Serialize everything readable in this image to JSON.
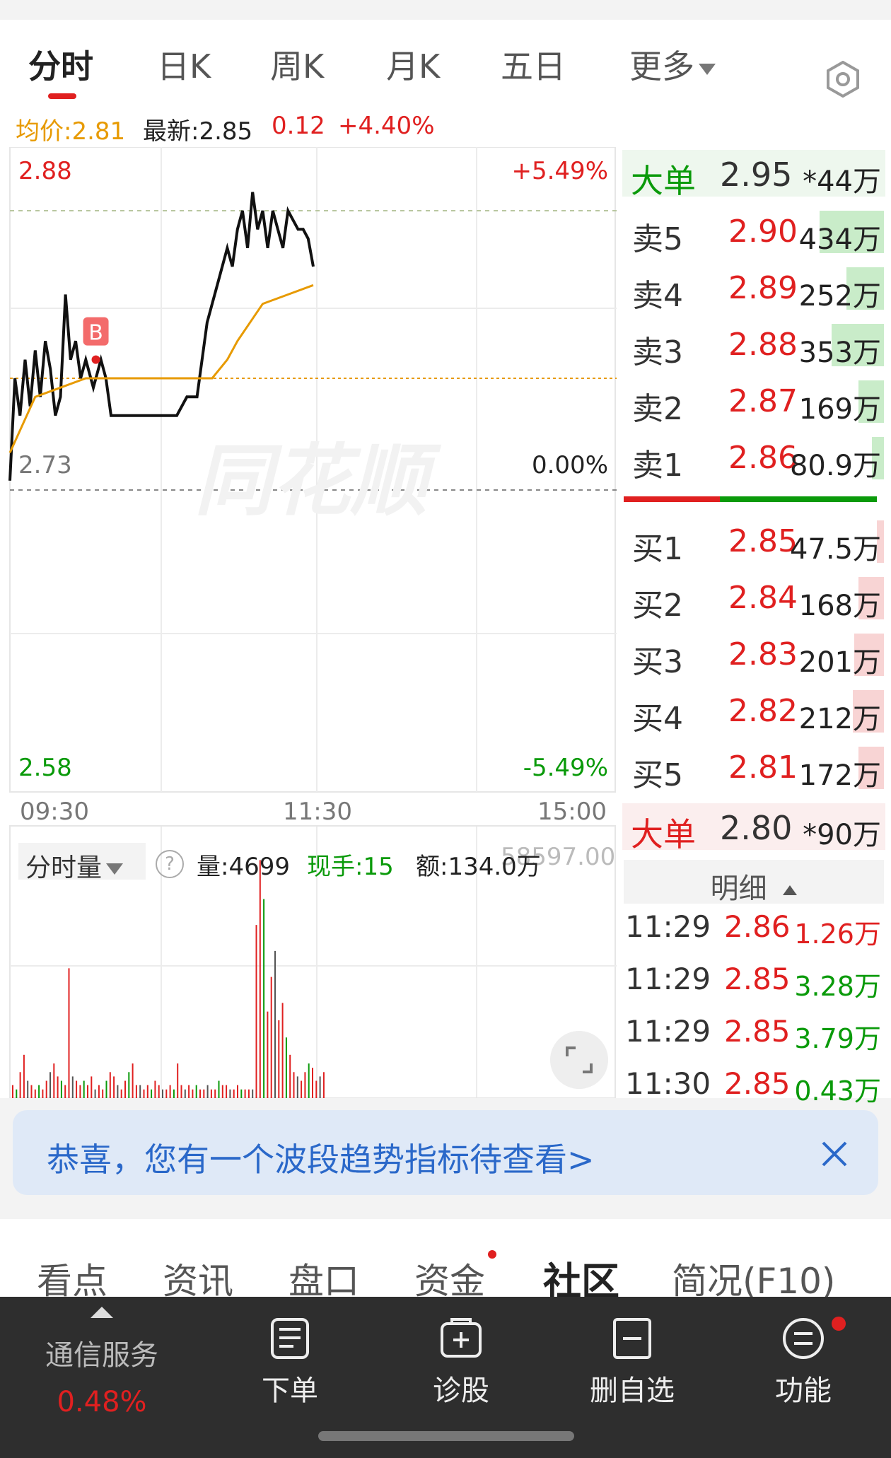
{
  "tabs": [
    {
      "label": "分时",
      "active": true
    },
    {
      "label": "日K",
      "active": false
    },
    {
      "label": "周K",
      "active": false
    },
    {
      "label": "月K",
      "active": false
    },
    {
      "label": "五日",
      "active": false
    },
    {
      "label": "更多",
      "active": false
    }
  ],
  "info": {
    "avg_price": "均价:2.81",
    "latest": "最新:2.85",
    "change": "0.12",
    "change_pct": "+4.40%"
  },
  "chart": {
    "price_high": "2.88",
    "price_mid": "2.73",
    "price_low": "2.58",
    "pct_high": "+5.49%",
    "pct_mid": "0.00%",
    "pct_low": "-5.49%",
    "time_start": "09:30",
    "time_mid": "11:30",
    "time_end": "15:00",
    "buy_marker": "B",
    "watermark": "同花顺"
  },
  "chart_data": {
    "type": "line",
    "x_range": [
      "09:30",
      "15:00"
    ],
    "ylim": [
      2.58,
      2.88
    ],
    "yref": 2.73,
    "series": [
      {
        "name": "price",
        "x_minutes": [
          0,
          2,
          4,
          6,
          8,
          10,
          12,
          14,
          16,
          18,
          20,
          22,
          24,
          26,
          28,
          30,
          33,
          36,
          38,
          40,
          42,
          44,
          46,
          50,
          54,
          58,
          62,
          66,
          70,
          74,
          78,
          82,
          86,
          88,
          90,
          92,
          94,
          96,
          98,
          100,
          102,
          104,
          106,
          108,
          110,
          112,
          114,
          116,
          118,
          120
        ],
        "y": [
          2.735,
          2.79,
          2.77,
          2.8,
          2.775,
          2.805,
          2.78,
          2.81,
          2.795,
          2.77,
          2.78,
          2.835,
          2.8,
          2.81,
          2.79,
          2.8,
          2.785,
          2.8,
          2.79,
          2.77,
          2.77,
          2.77,
          2.77,
          2.77,
          2.77,
          2.77,
          2.77,
          2.77,
          2.78,
          2.78,
          2.82,
          2.84,
          2.86,
          2.85,
          2.87,
          2.88,
          2.86,
          2.89,
          2.87,
          2.88,
          2.86,
          2.88,
          2.87,
          2.86,
          2.88,
          2.875,
          2.87,
          2.87,
          2.865,
          2.85
        ]
      },
      {
        "name": "avg",
        "x_minutes": [
          0,
          10,
          20,
          30,
          40,
          50,
          60,
          70,
          80,
          86,
          90,
          100,
          110,
          120
        ],
        "y": [
          2.75,
          2.78,
          2.785,
          2.79,
          2.79,
          2.79,
          2.79,
          2.79,
          2.79,
          2.8,
          2.81,
          2.83,
          2.835,
          2.84
        ]
      }
    ],
    "volume": [
      3,
      2,
      6,
      10,
      4,
      3,
      2,
      3,
      2,
      4,
      6,
      8,
      5,
      4,
      3,
      30,
      5,
      4,
      3,
      4,
      3,
      5,
      2,
      3,
      2,
      4,
      6,
      5,
      3,
      2,
      4,
      6,
      8,
      3,
      3,
      2,
      3,
      2,
      4,
      3,
      2,
      2,
      3,
      2,
      8,
      3,
      2,
      3,
      2,
      3,
      2,
      2,
      3,
      2,
      2,
      4,
      3,
      3,
      2,
      2,
      3,
      2,
      2,
      2,
      2,
      40,
      55,
      46,
      20,
      28,
      34,
      18,
      22,
      14,
      10,
      6,
      5,
      4,
      6,
      8,
      7,
      4,
      5,
      6
    ]
  },
  "volume_bar": {
    "selector": "分时量",
    "help": "?",
    "vol": "量:4699",
    "hand": "现手:15",
    "amount": "额:134.0万",
    "max_tick": "58597.00"
  },
  "book": {
    "big_sell": {
      "name": "大单",
      "price": "2.95",
      "vol": "*44万"
    },
    "sells": [
      {
        "name": "卖5",
        "price": "2.90",
        "vol": "434万",
        "ratio": 0.48
      },
      {
        "name": "卖4",
        "price": "2.89",
        "vol": "252万",
        "ratio": 0.28
      },
      {
        "name": "卖3",
        "price": "2.88",
        "vol": "353万",
        "ratio": 0.39
      },
      {
        "name": "卖2",
        "price": "2.87",
        "vol": "169万",
        "ratio": 0.19
      },
      {
        "name": "卖1",
        "price": "2.86",
        "vol": "80.9万",
        "ratio": 0.09
      }
    ],
    "buys": [
      {
        "name": "买1",
        "price": "2.85",
        "vol": "47.5万",
        "ratio": 0.05
      },
      {
        "name": "买2",
        "price": "2.84",
        "vol": "168万",
        "ratio": 0.19
      },
      {
        "name": "买3",
        "price": "2.83",
        "vol": "201万",
        "ratio": 0.22
      },
      {
        "name": "买4",
        "price": "2.82",
        "vol": "212万",
        "ratio": 0.23
      },
      {
        "name": "买5",
        "price": "2.81",
        "vol": "172万",
        "ratio": 0.19
      }
    ],
    "big_buy": {
      "name": "大单",
      "price": "2.80",
      "vol": "*90万"
    },
    "detail_label": "明细",
    "ticks": [
      {
        "time": "11:29",
        "price": "2.86",
        "vol": "1.26万",
        "dir": "sell"
      },
      {
        "time": "11:29",
        "price": "2.85",
        "vol": "3.28万",
        "dir": "buy"
      },
      {
        "time": "11:29",
        "price": "2.85",
        "vol": "3.79万",
        "dir": "buy"
      },
      {
        "time": "11:30",
        "price": "2.85",
        "vol": "0.43万",
        "dir": "buy"
      }
    ]
  },
  "banner": {
    "text": "恭喜，您有一个波段趋势指标待查看>"
  },
  "bottom_tabs": [
    "看点",
    "资讯",
    "盘口",
    "资金",
    "社区",
    "简况(F10)"
  ],
  "toolbar": {
    "sector_name": "通信服务",
    "sector_pct": "0.48%",
    "items": [
      "下单",
      "诊股",
      "删自选",
      "功能"
    ]
  },
  "colors": {
    "up": "#e02020",
    "down": "#0a9a0a",
    "avg_line": "#e79a00",
    "price_line": "#111111",
    "link": "#2a68c9"
  }
}
